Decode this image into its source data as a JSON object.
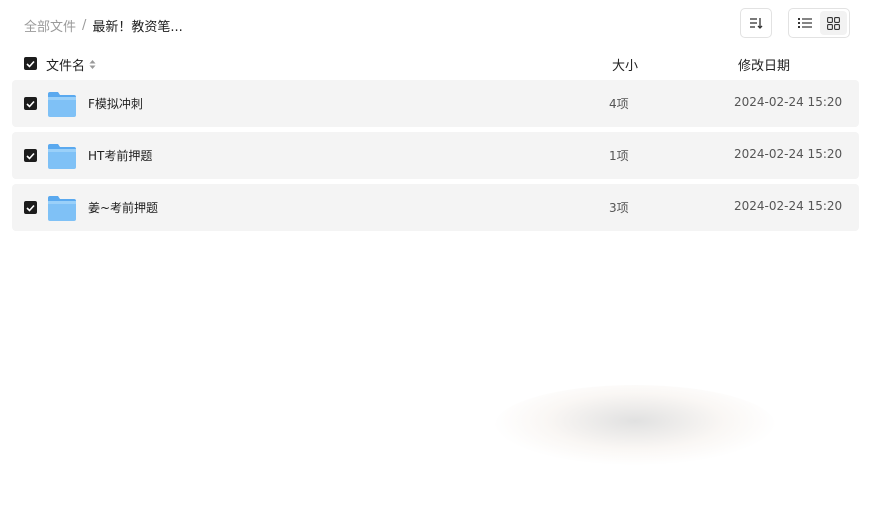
{
  "breadcrumb": {
    "root": "全部文件",
    "separator": "/",
    "current": "最新！教资笔..."
  },
  "toolbar": {
    "sort_icon": "sort-icon",
    "list_view_icon": "list-view-icon",
    "grid_view_icon": "grid-view-icon",
    "active_view": "list"
  },
  "table": {
    "columns": {
      "name": "文件名",
      "size": "大小",
      "modified": "修改日期"
    },
    "rows": [
      {
        "name": "F模拟冲刺",
        "size": "4项",
        "modified": "2024-02-24 15:20",
        "checked": true
      },
      {
        "name": "HT考前押题",
        "size": "1项",
        "modified": "2024-02-24 15:20",
        "checked": true
      },
      {
        "name": "姜~考前押题",
        "size": "3项",
        "modified": "2024-02-24 15:20",
        "checked": true
      }
    ]
  },
  "colors": {
    "row_background": "#f4f4f4",
    "folder_blue": "#6fb7f3",
    "checkbox": "#1c1c1c"
  }
}
